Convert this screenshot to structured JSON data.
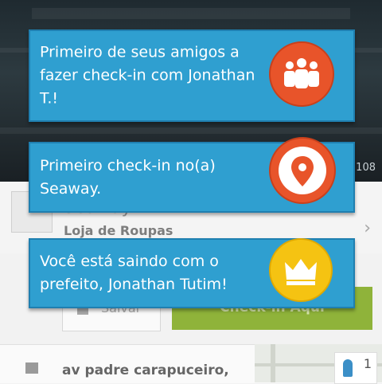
{
  "background": {
    "photo_count": "108",
    "venue": {
      "name": "Seaway",
      "category": "Loja de Roupas"
    },
    "save_label": "Salvar",
    "checkin_label": "Check-in Aqui",
    "address": "av padre carapuceiro,",
    "people_count": "1"
  },
  "toasts": [
    {
      "text": "Primeiro de seus amigos a fazer check-in com Jonathan T.!",
      "icon": "friends-icon",
      "icon_color": "#e8542a"
    },
    {
      "text": "Primeiro check-in no(a) Seaway.",
      "icon": "location-pin-icon",
      "icon_color": "#e8542a"
    },
    {
      "text": "Você está saindo com o prefeito, Jonathan Tutim!",
      "icon": "crown-icon",
      "icon_color": "#f5c312"
    }
  ],
  "colors": {
    "toast_bg": "#2f9fd0",
    "checkin_green": "#8fb33a"
  }
}
